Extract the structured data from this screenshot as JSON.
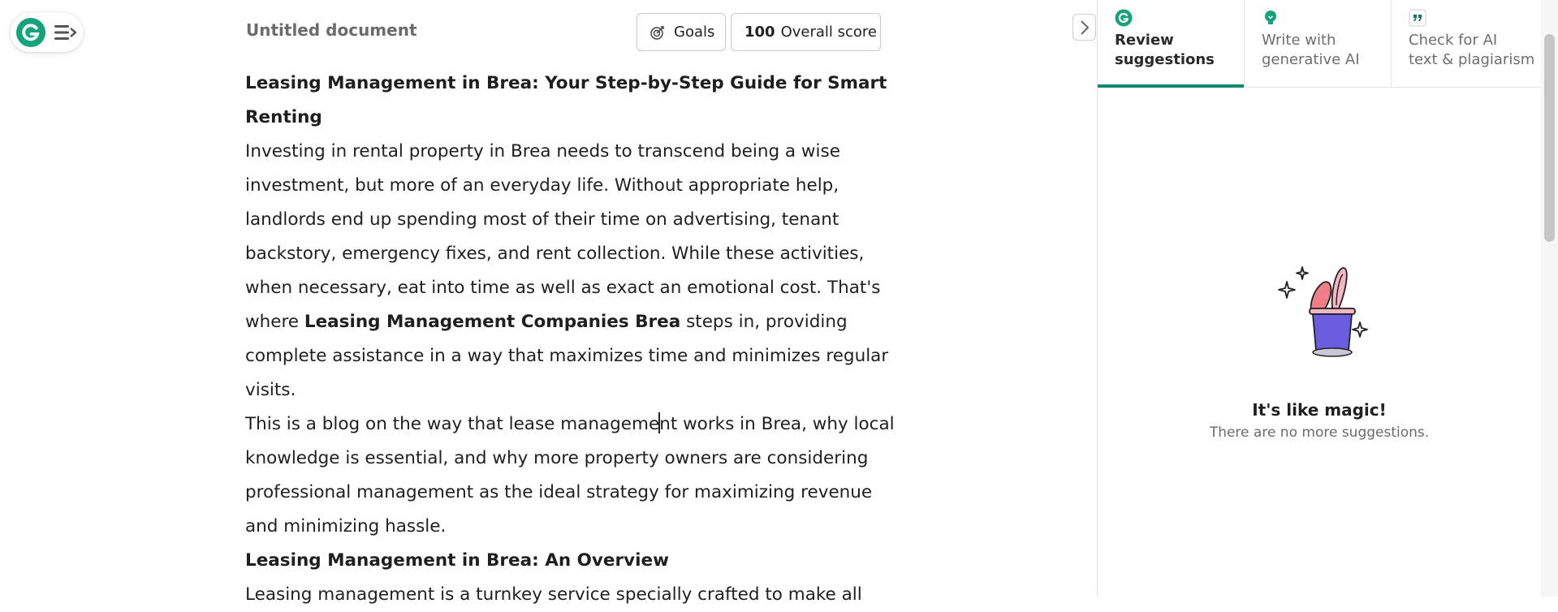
{
  "header": {
    "doc_title": "Untitled document",
    "goals_label": "Goals",
    "score_value": "100",
    "score_label": "Overall score"
  },
  "document": {
    "heading1": "Leasing Management in Brea: Your Step-by-Step Guide for Smart Renting",
    "para1_part1": "Investing in rental property in Brea needs to transcend being a wise investment, but more of an everyday life. Without appropriate help, landlords end up spending most of their time on advertising, tenant backstory, emergency fixes, and rent collection. While these activities, when necessary, eat into time as well as exact an emotional cost. That's where ",
    "para1_bold": "Leasing Management Companies Brea",
    "para1_part2": " steps in, providing complete assistance in a way that maximizes time and minimizes regular visits.",
    "para2_before_caret": "This is a blog on the way that lease manageme",
    "para2_after_caret": "nt works in Brea, why local knowledge is essential, and why more property owners are considering professional management as the ideal strategy for maximizing revenue and minimizing hassle.",
    "heading2": "Leasing Management in Brea: An Overview",
    "para3": "Leasing management is a turnkey service specially crafted to make all"
  },
  "panel": {
    "tabs": [
      {
        "label_line1": "Review",
        "label_line2": "suggestions",
        "icon": "grammarly-logo-icon",
        "active": true
      },
      {
        "label_line1": "Write with",
        "label_line2": "generative AI",
        "icon": "lightbulb-icon",
        "active": false
      },
      {
        "label_line1": "Check for AI",
        "label_line2": "text & plagiarism",
        "icon": "quote-icon",
        "active": false
      }
    ],
    "empty_title": "It's like magic!",
    "empty_subtitle": "There are no more suggestions."
  },
  "colors": {
    "brand_green": "#15a37c",
    "active_tab_underline": "#0e8a6b"
  }
}
